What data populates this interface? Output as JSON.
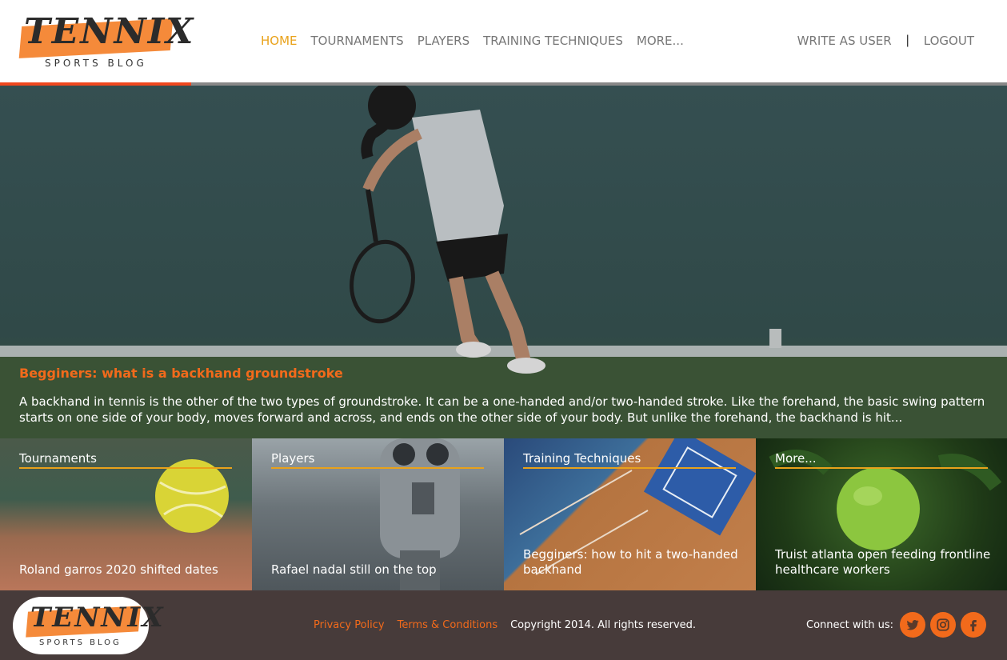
{
  "brand": {
    "name": "TENNIX",
    "tagline": "SPORTS BLOG"
  },
  "nav": {
    "items": [
      {
        "label": "HOME",
        "active": true
      },
      {
        "label": "TOURNAMENTS"
      },
      {
        "label": "PLAYERS"
      },
      {
        "label": "TRAINING TECHNIQUES"
      },
      {
        "label": "MORE..."
      }
    ]
  },
  "user_nav": {
    "write": "WRITE AS USER",
    "separator": "|",
    "logout": "LOGOUT"
  },
  "progress": {
    "fraction": 0.19
  },
  "hero": {
    "title": "Begginers: what is a backhand groundstroke",
    "excerpt": "A backhand in tennis is the other of the two types of groundstroke. It can be a one-handed and/or two-handed stroke. Like the forehand, the basic swing pattern starts on one side of your body, moves forward and across, and ends on the other side of your body. But unlike the forehand, the backhand is hit..."
  },
  "tiles": [
    {
      "category": "Tournaments",
      "caption": "Roland garros 2020 shifted dates"
    },
    {
      "category": "Players",
      "caption": "Rafael nadal still on the top"
    },
    {
      "category": "Training Techniques",
      "caption": "Begginers: how to hit a two-handed backhand"
    },
    {
      "category": "More...",
      "caption": "Truist atlanta open feeding frontline healthcare workers"
    }
  ],
  "footer": {
    "privacy": "Privacy Policy",
    "terms": "Terms & Conditions",
    "copyright": "Copyright 2014. All rights reserved.",
    "connect": "Connect with us:",
    "social": [
      "twitter-icon",
      "instagram-icon",
      "facebook-icon"
    ]
  },
  "colors": {
    "accent": "#f26a1b",
    "nav_active": "#e9a21b",
    "progress": "#f0471e",
    "footer_bg": "#473b3a"
  }
}
